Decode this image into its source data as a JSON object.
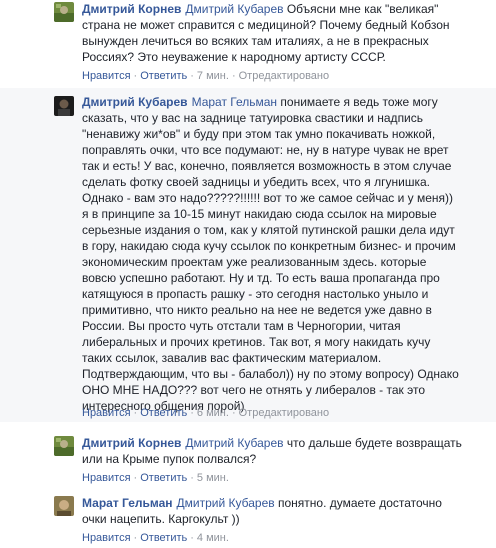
{
  "comments": [
    {
      "author": "Дмитрий Корнев",
      "mention": "Дмитрий Кубарев",
      "lines": [
        " Объясни мне как \"великая\"",
        "страна не может справится с медициной? Почему бедный Кобзон",
        "вынужден лечиться во всяких там италиях, а не в прекрасных",
        "Россиях? Это неуважение к народному артисту СССР."
      ],
      "like": "Нравится",
      "reply": "Ответить",
      "time": "7 мин.",
      "edited": "Отредактировано"
    },
    {
      "author": "Дмитрий Кубарев",
      "mention": "Марат Гельман",
      "lines": [
        " понимаете я ведь тоже могу",
        "сказать, что у вас на заднице татуировка свастики и надпись",
        "\"ненавижу жи*ов\" и буду при этом так умно покачивать ножкой,",
        "поправлять очки, что все подумают: не, ну в натуре чувак не врет",
        "так и есть! У вас, конечно, появляется возможность в этом случае",
        "сделать фотку своей задницы и убедить всех, что я лгунишка.",
        "Однако - вам это надо?????!!!!!! вот то же самое сейчас и у меня))",
        "я в принципе за 10-15 минут накидаю сюда ссылок на мировые",
        "серьезные издания о том, как у клятой путинской рашки дела идут",
        "в гору, накидаю сюда кучу ссылок по конкретным бизнес- и прочим",
        "экономическим проектам уже реализованным здесь. которые",
        "вовсю успешно работают. Ну и тд. То есть ваша пропаганда про",
        "катящуюся в пропасть рашку - это сегодня настолько уныло и",
        "примитивно, что никто реально на нее не ведется уже давно в",
        "России. Вы просто чуть отстали там в Черногории, читая",
        "либеральных и прочих кретинов. Так вот, я могу накидать кучу",
        "таких ссылок, завалив вас фактическим материалом.",
        "Подтверждающим, что вы - балабол)) ну по этому вопросу) Однако",
        "ОНО МНЕ НАДО??? вот чего не отнять у либералов - так это",
        "интересного общения порой)"
      ],
      "like": "Нравится",
      "reply": "Ответить",
      "time": "6 мин.",
      "edited": "Отредактировано"
    },
    {
      "author": "Дмитрий Корнев",
      "mention": "Дмитрий Кубарев",
      "lines": [
        " что дальше будете возвращать",
        "или на Крыме пупок полвался?"
      ],
      "like": "Нравится",
      "reply": "Ответить",
      "time": "5 мин.",
      "edited": ""
    },
    {
      "author": "Марат Гельман",
      "mention": "Дмитрий Кубарев",
      "lines": [
        " понятно. думаете достаточно",
        "очки нацепить. Каргокульт ))"
      ],
      "like": "Нравится",
      "reply": "Ответить",
      "time": "4 мин.",
      "edited": ""
    }
  ],
  "separator": "·"
}
